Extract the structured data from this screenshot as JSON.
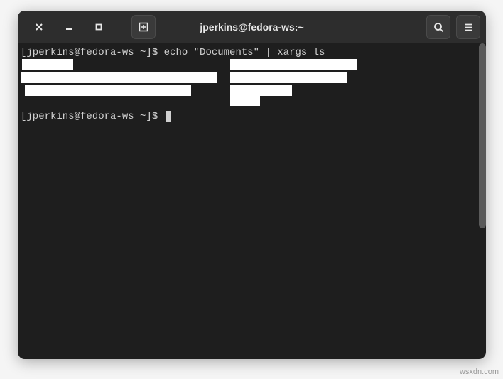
{
  "titlebar": {
    "title": "jperkins@fedora-ws:~"
  },
  "terminal": {
    "prompt1": "[jperkins@fedora-ws ~]$ ",
    "command1": "echo \"Documents\" | xargs ls",
    "prompt2": "[jperkins@fedora-ws ~]$ "
  },
  "watermark": "wsxdn.com"
}
